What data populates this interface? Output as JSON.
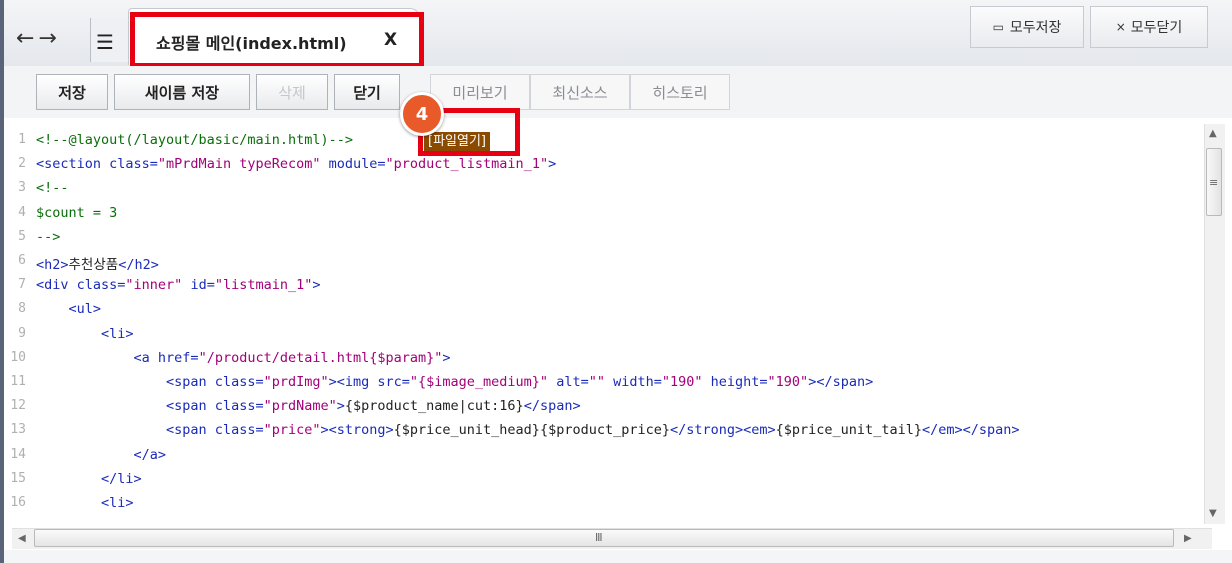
{
  "nav": {
    "back_forward_icon": "arrow-left-right",
    "list_icon": "list-icon"
  },
  "tab": {
    "label": "쇼핑몰 메인(index.html)",
    "close": "X"
  },
  "top_buttons": {
    "save_all": "모두저장",
    "close_all": "모두닫기"
  },
  "toolbar": {
    "save": "저장",
    "save_as": "새이름 저장",
    "delete": "삭제",
    "close": "닫기",
    "preview": "미리보기",
    "latest_source": "최신소스",
    "history": "히스토리"
  },
  "badge": {
    "number": "4"
  },
  "open_file_button": "[파일열기]",
  "code_lines": [
    {
      "n": "1",
      "segments": [
        {
          "t": "<!--@layout(/layout/basic/main.html)-->",
          "c": "c-com"
        }
      ]
    },
    {
      "n": "2",
      "segments": [
        {
          "t": "<section class=",
          "c": "c-tag"
        },
        {
          "t": "\"mPrdMain typeRecom\"",
          "c": "c-str"
        },
        {
          "t": " module=",
          "c": "c-tag"
        },
        {
          "t": "\"product_listmain_1\"",
          "c": "c-str"
        },
        {
          "t": ">",
          "c": "c-tag"
        }
      ]
    },
    {
      "n": "3",
      "segments": [
        {
          "t": "<!--",
          "c": "c-com"
        }
      ]
    },
    {
      "n": "4",
      "segments": [
        {
          "t": "$count = 3",
          "c": "c-com"
        }
      ]
    },
    {
      "n": "5",
      "segments": [
        {
          "t": "-->",
          "c": "c-com"
        }
      ]
    },
    {
      "n": "6",
      "segments": [
        {
          "t": "<h2>",
          "c": "c-tag"
        },
        {
          "t": "추천상품",
          "c": "c-var"
        },
        {
          "t": "</h2>",
          "c": "c-tag"
        }
      ]
    },
    {
      "n": "7",
      "segments": [
        {
          "t": "<div class=",
          "c": "c-tag"
        },
        {
          "t": "\"inner\"",
          "c": "c-str"
        },
        {
          "t": " id=",
          "c": "c-tag"
        },
        {
          "t": "\"listmain_1\"",
          "c": "c-str"
        },
        {
          "t": ">",
          "c": "c-tag"
        }
      ]
    },
    {
      "n": "8",
      "segments": [
        {
          "t": "    <ul>",
          "c": "c-tag"
        }
      ]
    },
    {
      "n": "9",
      "segments": [
        {
          "t": "        <li>",
          "c": "c-tag"
        }
      ]
    },
    {
      "n": "10",
      "segments": [
        {
          "t": "            <a href=",
          "c": "c-tag"
        },
        {
          "t": "\"/product/detail.html{$param}\"",
          "c": "c-str"
        },
        {
          "t": ">",
          "c": "c-tag"
        }
      ]
    },
    {
      "n": "11",
      "segments": [
        {
          "t": "                <span class=",
          "c": "c-tag"
        },
        {
          "t": "\"prdImg\"",
          "c": "c-str"
        },
        {
          "t": "><img src=",
          "c": "c-tag"
        },
        {
          "t": "\"{$image_medium}\"",
          "c": "c-str"
        },
        {
          "t": " alt=",
          "c": "c-tag"
        },
        {
          "t": "\"\"",
          "c": "c-str"
        },
        {
          "t": " width=",
          "c": "c-tag"
        },
        {
          "t": "\"190\"",
          "c": "c-str"
        },
        {
          "t": " height=",
          "c": "c-tag"
        },
        {
          "t": "\"190\"",
          "c": "c-str"
        },
        {
          "t": "></span>",
          "c": "c-tag"
        }
      ]
    },
    {
      "n": "12",
      "segments": [
        {
          "t": "                <span class=",
          "c": "c-tag"
        },
        {
          "t": "\"prdName\"",
          "c": "c-str"
        },
        {
          "t": ">",
          "c": "c-tag"
        },
        {
          "t": "{$product_name|cut:16}",
          "c": "c-var"
        },
        {
          "t": "</span>",
          "c": "c-tag"
        }
      ]
    },
    {
      "n": "13",
      "segments": [
        {
          "t": "                <span class=",
          "c": "c-tag"
        },
        {
          "t": "\"price\"",
          "c": "c-str"
        },
        {
          "t": "><strong>",
          "c": "c-tag"
        },
        {
          "t": "{$price_unit_head}{$product_price}",
          "c": "c-var"
        },
        {
          "t": "</strong><em>",
          "c": "c-tag"
        },
        {
          "t": "{$price_unit_tail}",
          "c": "c-var"
        },
        {
          "t": "</em></span>",
          "c": "c-tag"
        }
      ]
    },
    {
      "n": "14",
      "segments": [
        {
          "t": "            </a>",
          "c": "c-tag"
        }
      ]
    },
    {
      "n": "15",
      "segments": [
        {
          "t": "        </li>",
          "c": "c-tag"
        }
      ]
    },
    {
      "n": "16",
      "segments": [
        {
          "t": "        <li>",
          "c": "c-tag"
        }
      ]
    }
  ],
  "highlight_color": "#e60012",
  "badge_color": "#e85a2a"
}
